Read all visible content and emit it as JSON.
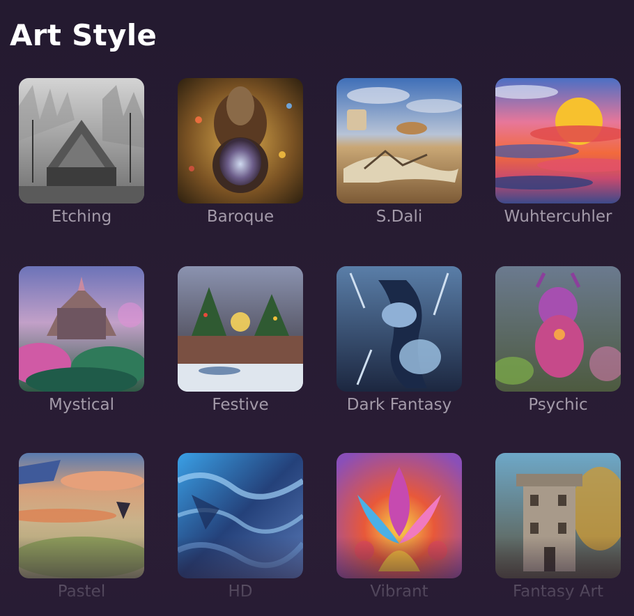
{
  "header": {
    "title": "Art Style"
  },
  "styles": [
    {
      "label": "Etching"
    },
    {
      "label": "Baroque"
    },
    {
      "label": "S.Dali"
    },
    {
      "label": "Wuhtercuhler"
    },
    {
      "label": "Mystical"
    },
    {
      "label": "Festive"
    },
    {
      "label": "Dark Fantasy"
    },
    {
      "label": "Psychic"
    },
    {
      "label": "Pastel"
    },
    {
      "label": "HD"
    },
    {
      "label": "Vibrant"
    },
    {
      "label": "Fantasy Art"
    }
  ]
}
